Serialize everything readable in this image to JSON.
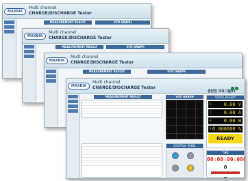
{
  "app": {
    "title_line1": "Multi channel",
    "title_line2": "CHARGE/DISCHARGE Tester",
    "logo_text": "MAXBIA",
    "status_label_1": "Lock",
    "status_label_2": "PC"
  },
  "measurement": {
    "title": "MEASUREMENT RESULT"
  },
  "graph": {
    "title": "VI/D GRAPH"
  },
  "side_title": "충방전 프로그램01",
  "reset_label": "VDATA_RESERT",
  "readouts": [
    {
      "label": "V",
      "value": "0.00 V"
    },
    {
      "label": "I",
      "value": "0.00 A"
    },
    {
      "label": "W",
      "value": "0.00 W"
    },
    {
      "label": "R",
      "value": "0.000000 %"
    }
  ],
  "status": "READY",
  "control_title": "CONTROL PANEL",
  "time_title": "TIME",
  "time_value": "00:00:00:000",
  "count_value_1": "0",
  "count_value_2": "0",
  "colors": {
    "accent": "#3d6a9a",
    "ready": "#f5d918",
    "graph_bg": "#0e0e0e",
    "clock": "#d2221e"
  }
}
